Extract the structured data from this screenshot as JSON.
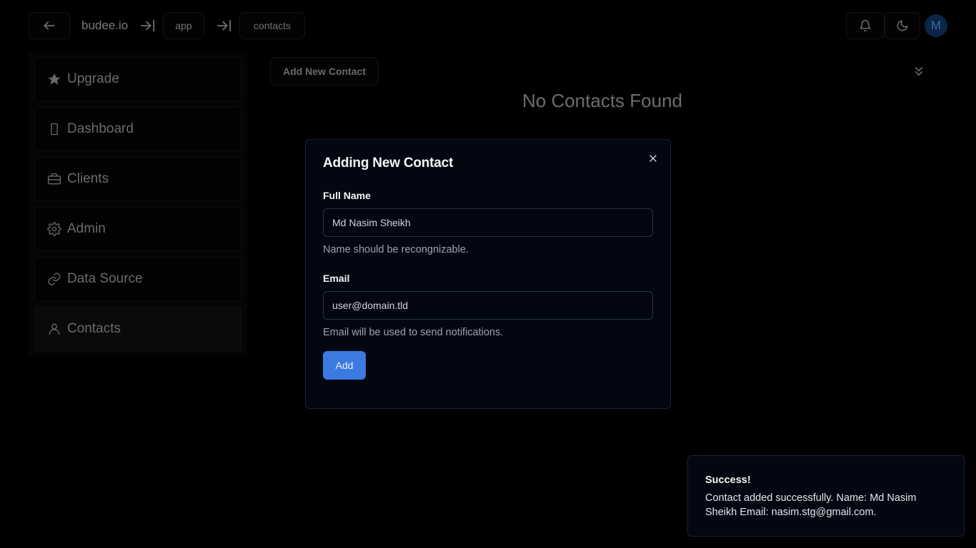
{
  "topbar": {
    "brand": "budee.io",
    "crumbs": [
      "app",
      "contacts"
    ],
    "avatar_initial": "M",
    "icons": {
      "back": "arrow-left-icon",
      "separator": "arrow-right-to-line-icon",
      "notifications": "bell-icon",
      "theme": "moon-icon"
    }
  },
  "sidebar": {
    "items": [
      {
        "label": "Upgrade",
        "icon": "star-icon"
      },
      {
        "label": "Dashboard",
        "icon": "building-icon"
      },
      {
        "label": "Clients",
        "icon": "briefcase-icon"
      },
      {
        "label": "Admin",
        "icon": "gear-icon"
      },
      {
        "label": "Data Source",
        "icon": "link-icon"
      },
      {
        "label": "Contacts",
        "icon": "user-icon",
        "active": true
      }
    ]
  },
  "main": {
    "add_contact_label": "Add New Contact",
    "empty_title": "No Contacts Found"
  },
  "modal": {
    "title": "Adding New Contact",
    "full_name_label": "Full Name",
    "full_name_value": "Md Nasim Sheikh",
    "full_name_hint": "Name should be recongnizable.",
    "email_label": "Email",
    "email_placeholder": "user@domain.tld",
    "email_hint": "Email will be used to send notifications.",
    "submit_label": "Add"
  },
  "toast": {
    "title": "Success!",
    "message": "Contact added successfully. Name: Md Nasim Sheikh Email: nasim.stg@gmail.com."
  },
  "colors": {
    "background": "#000000",
    "modal_bg": "#030712",
    "primary_button": "#3b7ae0"
  }
}
